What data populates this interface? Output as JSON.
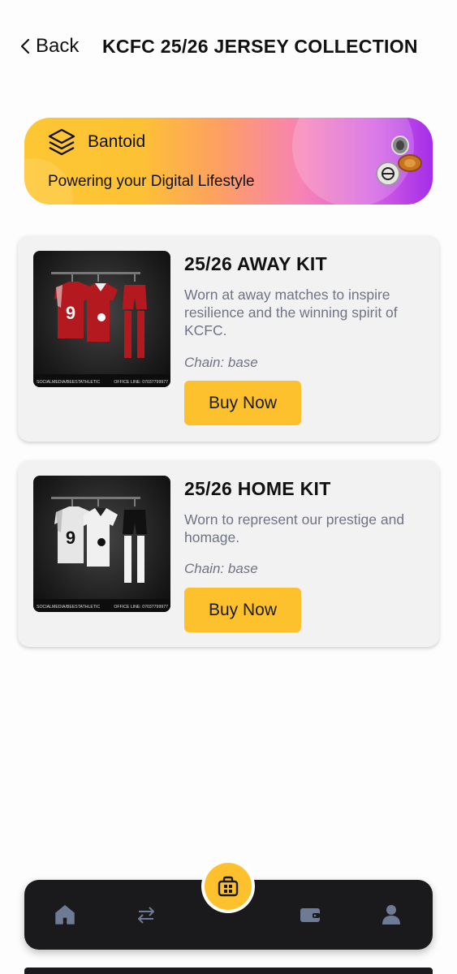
{
  "header": {
    "back_label": "Back",
    "title": "KCFC 25/26 JERSEY COLLECTION"
  },
  "banner": {
    "brand_name": "Bantoid",
    "tagline": "Powering your Digital Lifestyle",
    "icon": "layers-icon"
  },
  "products": [
    {
      "title": "25/26 AWAY KIT",
      "description": "Worn at away matches to inspire resilience and the winning spirit of KCFC.",
      "chain": "Chain: base",
      "button_label": "Buy Now",
      "jersey_color": "#b3191f",
      "jersey_number": "9",
      "footer_left": "SOCIALMEDIA/BEESTATHLETIC",
      "footer_right": "OFFICE LINE: 07037799977"
    },
    {
      "title": "25/26 HOME KIT",
      "description": "Worn to represent our prestige and homage.",
      "chain": "Chain: base",
      "button_label": "Buy Now",
      "jersey_color": "#e6e6e6",
      "jersey_number": "9",
      "footer_left": "SOCIALMEDIA/BEESTATHLETIC",
      "footer_right": "OFFICE LINE: 07037799977"
    }
  ],
  "nav": {
    "items": [
      "home-icon",
      "swap-icon",
      "shop-icon",
      "wallet-icon",
      "profile-icon"
    ],
    "accent": "#fcc12d",
    "icon_color": "#6d7b95",
    "background": "#1a1a1c"
  }
}
